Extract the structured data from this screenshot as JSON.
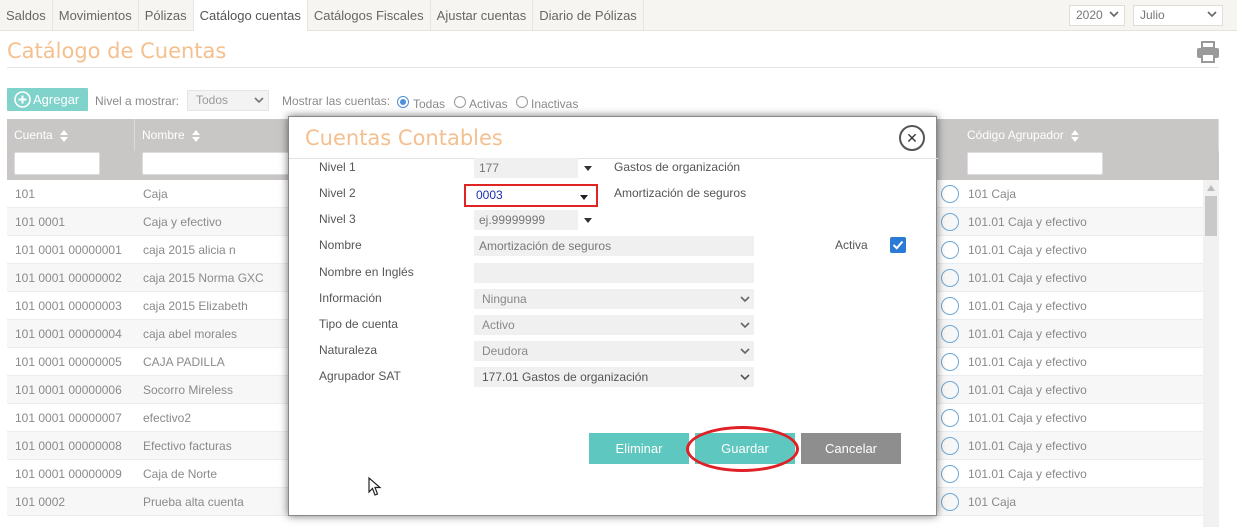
{
  "nav": {
    "tabs": [
      "Saldos",
      "Movimientos",
      "Pólizas",
      "Catálogo cuentas",
      "Catálogos Fiscales",
      "Ajustar cuentas",
      "Diario de Pólizas"
    ],
    "active_tab": "Catálogo cuentas",
    "year": "2020",
    "month": "Julio"
  },
  "page": {
    "title": "Catálogo de Cuentas",
    "add_label": "Agregar",
    "nivel_label": "Nivel a mostrar:",
    "nivel_value": "Todos",
    "mostrar_label": "Mostrar las cuentas:",
    "radios": [
      "Todas",
      "Activas",
      "Inactivas"
    ],
    "radio_selected": "Todas"
  },
  "table": {
    "columns": [
      "Cuenta",
      "Nombre",
      "Código Agrupador"
    ],
    "rows": [
      {
        "cuenta": "101",
        "nombre": "Caja",
        "agrupador": "101 Caja"
      },
      {
        "cuenta": "101 0001",
        "nombre": "Caja y efectivo",
        "agrupador": "101.01 Caja y efectivo"
      },
      {
        "cuenta": "101 0001 00000001",
        "nombre": "caja 2015 alicia n",
        "agrupador": "101.01 Caja y efectivo"
      },
      {
        "cuenta": "101 0001 00000002",
        "nombre": "caja 2015 Norma GXC",
        "agrupador": "101.01 Caja y efectivo"
      },
      {
        "cuenta": "101 0001 00000003",
        "nombre": "caja 2015 Elizabeth",
        "agrupador": "101.01 Caja y efectivo"
      },
      {
        "cuenta": "101 0001 00000004",
        "nombre": "caja abel morales",
        "agrupador": "101.01 Caja y efectivo"
      },
      {
        "cuenta": "101 0001 00000005",
        "nombre": "CAJA PADILLA",
        "agrupador": "101.01 Caja y efectivo"
      },
      {
        "cuenta": "101 0001 00000006",
        "nombre": "Socorro Mireless",
        "agrupador": "101.01 Caja y efectivo"
      },
      {
        "cuenta": "101 0001 00000007",
        "nombre": "efectivo2",
        "agrupador": "101.01 Caja y efectivo"
      },
      {
        "cuenta": "101 0001 00000008",
        "nombre": "Efectivo facturas",
        "agrupador": "101.01 Caja y efectivo"
      },
      {
        "cuenta": "101 0001 00000009",
        "nombre": "Caja de Norte",
        "agrupador": "101.01 Caja y efectivo"
      },
      {
        "cuenta": "101 0002",
        "nombre": "Prueba alta cuenta",
        "agrupador": "101 Caja"
      }
    ]
  },
  "modal": {
    "title": "Cuentas Contables",
    "nivel1_label": "Nivel 1",
    "nivel1_value": "177",
    "nivel1_desc": "Gastos de organización",
    "nivel2_label": "Nivel 2",
    "nivel2_value": "0003",
    "nivel2_desc": "Amortización de seguros",
    "nivel3_label": "Nivel 3",
    "nivel3_placeholder": "ej.99999999",
    "nombre_label": "Nombre",
    "nombre_value": "Amortización de seguros",
    "activa_label": "Activa",
    "nombre_ingles_label": "Nombre en Inglés",
    "nombre_ingles_value": "",
    "informacion_label": "Información",
    "informacion_value": "Ninguna",
    "tipo_label": "Tipo de cuenta",
    "tipo_value": "Activo",
    "naturaleza_label": "Naturaleza",
    "naturaleza_value": "Deudora",
    "agrupador_label": "Agrupador SAT",
    "agrupador_value": "177.01 Gastos de organización",
    "eliminar": "Eliminar",
    "guardar": "Guardar",
    "cancelar": "Cancelar"
  },
  "colors": {
    "accent_teal": "#5ec7bf",
    "title_orange": "#f5c08f",
    "cancel_gray": "#8e8e8e",
    "highlight_red": "#e01f26"
  }
}
